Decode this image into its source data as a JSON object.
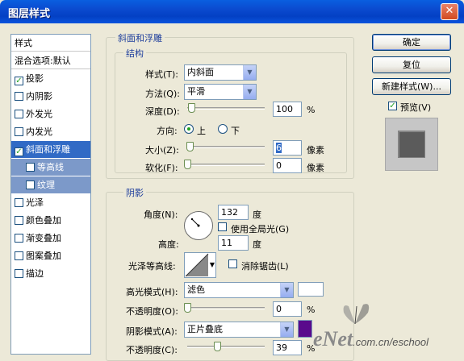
{
  "window": {
    "title": "图层样式",
    "close_glyph": "✕"
  },
  "style_list": {
    "header": "样式",
    "blend_default": "混合选项:默认",
    "items": [
      {
        "label": "投影",
        "checked": true
      },
      {
        "label": "内阴影",
        "checked": false
      },
      {
        "label": "外发光",
        "checked": false
      },
      {
        "label": "内发光",
        "checked": false
      },
      {
        "label": "斜面和浮雕",
        "checked": true,
        "selected": true
      },
      {
        "label": "等高线",
        "checked": false,
        "sub": true
      },
      {
        "label": "纹理",
        "checked": false,
        "sub": true
      },
      {
        "label": "光泽",
        "checked": false
      },
      {
        "label": "颜色叠加",
        "checked": false
      },
      {
        "label": "渐变叠加",
        "checked": false
      },
      {
        "label": "图案叠加",
        "checked": false
      },
      {
        "label": "描边",
        "checked": false
      }
    ]
  },
  "bevel": {
    "group_title": "斜面和浮雕",
    "structure_title": "结构",
    "style_label": "样式(T):",
    "style_value": "内斜面",
    "technique_label": "方法(Q):",
    "technique_value": "平滑",
    "depth_label": "深度(D):",
    "depth_value": "100",
    "depth_unit": "%",
    "depth_level": 0.05,
    "direction_label": "方向:",
    "direction_up": "上",
    "direction_down": "下",
    "size_label": "大小(Z):",
    "size_value": "6",
    "size_unit": "像素",
    "size_level": 0.03,
    "soften_label": "软化(F):",
    "soften_value": "0",
    "soften_unit": "像素",
    "soften_level": 0.0
  },
  "shading": {
    "group_title": "阴影",
    "angle_label": "角度(N):",
    "angle_value": "132",
    "angle_unit": "度",
    "global_light_label": "使用全局光(G)",
    "altitude_label": "高度:",
    "altitude_value": "11",
    "altitude_unit": "度",
    "gloss_label": "光泽等高线:",
    "antialias_label": "消除锯齿(L)",
    "highlight_mode_label": "高光模式(H):",
    "highlight_mode_value": "滤色",
    "highlight_color": "#FFFFFF",
    "highlight_opacity_label": "不透明度(O):",
    "highlight_opacity_value": "0",
    "highlight_opacity_unit": "%",
    "highlight_opacity_level": 0.0,
    "shadow_mode_label": "阴影模式(A):",
    "shadow_mode_value": "正片叠底",
    "shadow_color": "#5A0A8C",
    "shadow_opacity_label": "不透明度(C):",
    "shadow_opacity_value": "39",
    "shadow_opacity_unit": "%",
    "shadow_opacity_level": 0.39
  },
  "buttons": {
    "ok": "确定",
    "reset": "复位",
    "new_style": "新建样式(W)...",
    "preview_label": "预览(V)"
  },
  "watermark": {
    "brand": "eNet",
    "url": ".com.cn/eschool"
  },
  "colors": {
    "title_bar": "#0A54DD",
    "selection": "#316AC5",
    "sub_selection": "#7C99C9",
    "group_text": "#1E3E9C",
    "preview_square": "#5B5B5B"
  }
}
